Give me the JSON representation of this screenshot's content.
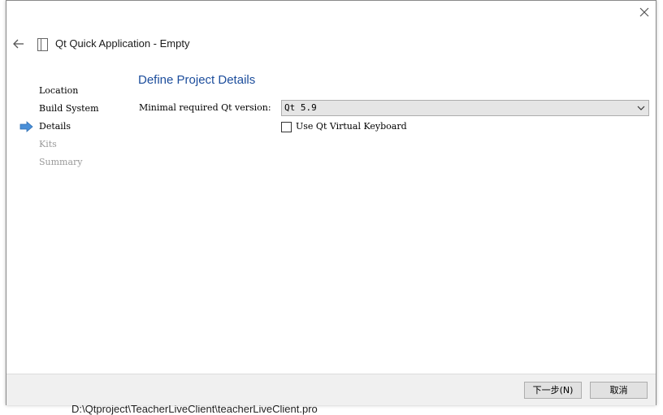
{
  "background": {
    "path_text": "D:\\Qtproject\\TeacherLiveClient\\teacherLiveClient.pro"
  },
  "window": {
    "title": "Qt Quick Application - Empty"
  },
  "steps": [
    {
      "label": "Location",
      "state": "done"
    },
    {
      "label": "Build System",
      "state": "done"
    },
    {
      "label": "Details",
      "state": "current"
    },
    {
      "label": "Kits",
      "state": "pending"
    },
    {
      "label": "Summary",
      "state": "pending"
    }
  ],
  "page": {
    "title": "Define Project Details",
    "qt_version_label": "Minimal required Qt version:",
    "qt_version_value": "Qt 5.9",
    "virtual_keyboard_label": "Use Qt Virtual Keyboard",
    "virtual_keyboard_checked": false
  },
  "buttons": {
    "next": "下一步(N)",
    "cancel": "取消"
  },
  "colors": {
    "title_blue": "#1c4d9c",
    "arrow_blue": "#4a8fd8",
    "inactive_step": "#9a9a9a"
  },
  "icons": {
    "close": "close-icon",
    "back": "back-arrow-icon",
    "document": "document-icon",
    "current_step": "current-step-arrow-icon",
    "dropdown": "chevron-down-icon"
  }
}
